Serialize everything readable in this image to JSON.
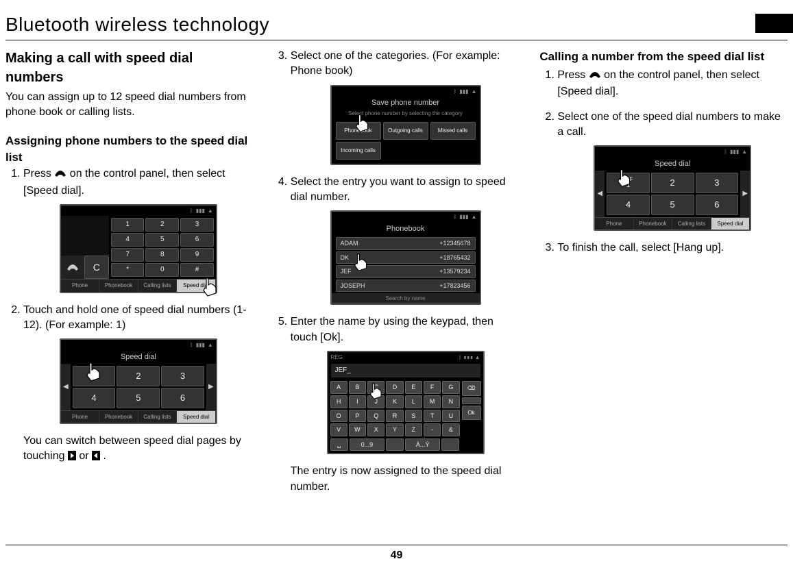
{
  "page_number": "49",
  "header": "Bluetooth wireless technology",
  "col1": {
    "h1": "Making a call with speed dial numbers",
    "intro": "You can assign up to 12 speed dial numbers from phone book or calling lists.",
    "h2": "Assigning phone numbers to the speed dial list",
    "step1_a": "Press ",
    "step1_b": " on the control panel, then select [Speed dial].",
    "step2": "Touch and hold one of speed dial numbers (1-12). (For example: 1)",
    "note2_a": "You can switch between speed dial pages by touching ",
    "note2_b": " or ",
    "note2_c": "."
  },
  "col2": {
    "step3": "Select one of the categories. (For example: Phone book)",
    "step4": "Select the entry you want to assign to speed dial number.",
    "step5": "Enter the name by using the keypad, then touch [Ok].",
    "note5": "The entry is now assigned to the speed dial number."
  },
  "col3": {
    "h1": "Calling a number from the speed dial list",
    "step1_a": "Press ",
    "step1_b": " on the control panel, then select [Speed dial].",
    "step2": "Select one of the speed dial numbers to make a call.",
    "step3": "To finish the call, select [Hang up]."
  },
  "screens": {
    "dialer": {
      "keys_row1": [
        "1",
        "2",
        "3"
      ],
      "keys_row2": [
        "4",
        "5",
        "6"
      ],
      "keys_row3": [
        "7",
        "8",
        "9"
      ],
      "keys_row4": [
        "*",
        "0",
        "#"
      ],
      "c_key": "C",
      "tabs": [
        "Phone",
        "Phonebook",
        "Calling lists",
        "Speed dial"
      ]
    },
    "speed_dial": {
      "title": "Speed dial",
      "keys_row1": [
        "1",
        "2",
        "3"
      ],
      "keys_row2": [
        "4",
        "5",
        "6"
      ],
      "tabs": [
        "Phone",
        "Phonebook",
        "Calling lists",
        "Speed dial"
      ]
    },
    "save_phone": {
      "title": "Save phone number",
      "subtitle": "Select phone number by selecting the category",
      "buttons": [
        "Phonebook",
        "Outgoing calls",
        "Missed calls",
        "Incoming calls"
      ]
    },
    "phonebook": {
      "title": "Phonebook",
      "rows": [
        {
          "name": "ADAM",
          "num": "+12345678"
        },
        {
          "name": "DK",
          "num": "+18765432"
        },
        {
          "name": "JEF",
          "num": "+13579234"
        },
        {
          "name": "JOSEPH",
          "num": "+17823456"
        }
      ],
      "search": "Search by name"
    },
    "keyboard": {
      "reg": "REG",
      "field": "JEF_",
      "rows": [
        [
          "A",
          "B",
          "C",
          "D",
          "E",
          "F",
          "G"
        ],
        [
          "H",
          "I",
          "J",
          "K",
          "L",
          "M",
          "N"
        ],
        [
          "O",
          "P",
          "Q",
          "R",
          "S",
          "T",
          "U"
        ],
        [
          "V",
          "W",
          "X",
          "Y",
          "Z",
          "-",
          "&"
        ]
      ],
      "bottom": [
        "␣",
        "0...9",
        "",
        "À...Ý",
        ""
      ],
      "side": [
        "⌫",
        "",
        "Ok"
      ]
    },
    "speed_dial2": {
      "title": "Speed dial",
      "jef": "JEF",
      "keys_row1": [
        "1",
        "2",
        "3"
      ],
      "keys_row2": [
        "4",
        "5",
        "6"
      ],
      "tabs": [
        "Phone",
        "Phonebook",
        "Calling lists",
        "Speed dial"
      ]
    }
  }
}
